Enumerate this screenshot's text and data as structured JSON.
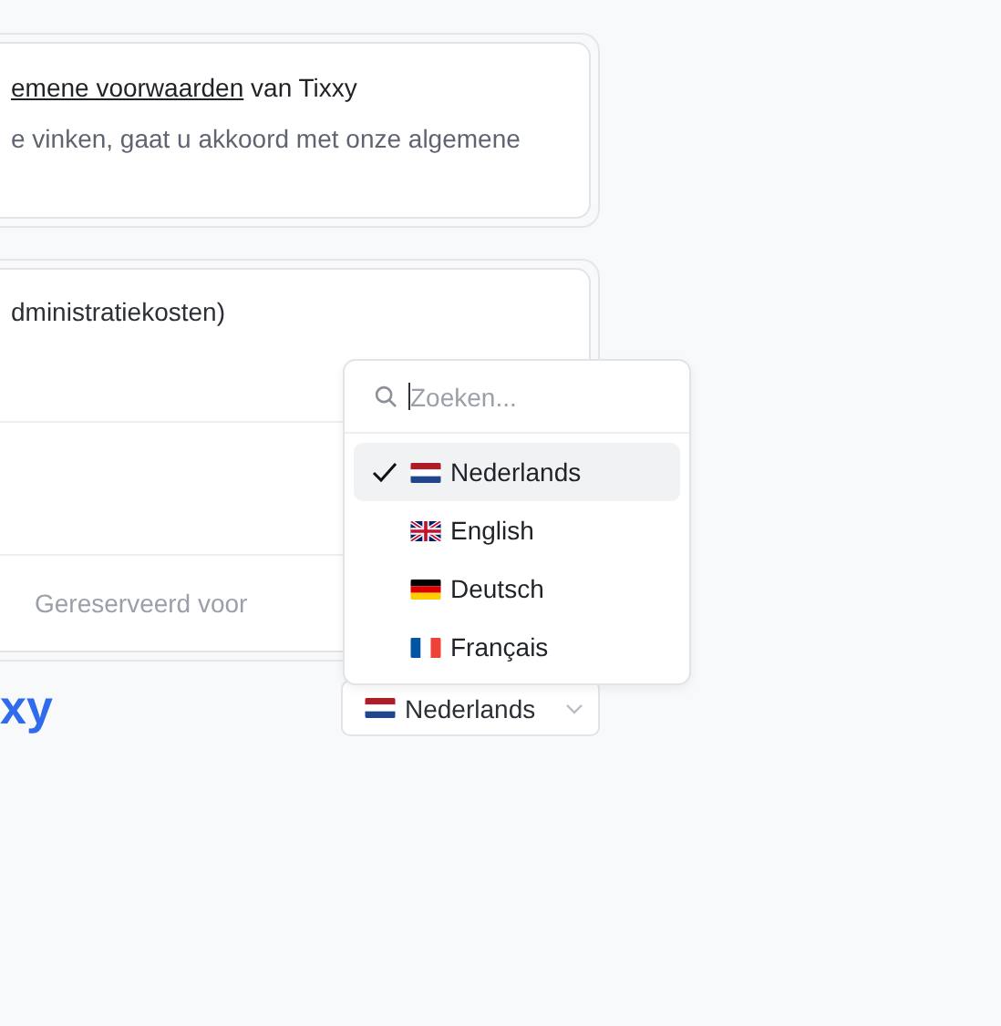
{
  "terms_card": {
    "title_link": "emene voorwaarden",
    "title_rest": "van Tixxy",
    "description": "e vinken, gaat u akkoord met onze algemene"
  },
  "order_card": {
    "fee_text": "dministratiekosten)",
    "reserved_label": "Gereserveerd voor"
  },
  "logo": "xy",
  "language_menu": {
    "search": {
      "placeholder": "Zoeken..."
    },
    "options": [
      {
        "label": "Nederlands",
        "kind": "nl",
        "selected": true
      },
      {
        "label": "English",
        "kind": "gb",
        "selected": false
      },
      {
        "label": "Deutsch",
        "kind": "de",
        "selected": false
      },
      {
        "label": "Français",
        "kind": "fr",
        "selected": false
      }
    ]
  },
  "language_button": {
    "label": "Nederlands",
    "kind": "nl"
  }
}
